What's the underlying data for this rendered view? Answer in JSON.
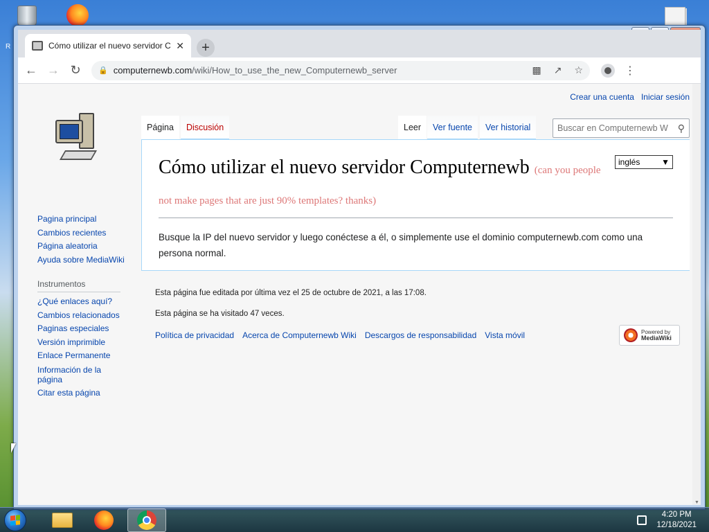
{
  "desktop": {
    "left_label": "R",
    "right_label": "......"
  },
  "browser": {
    "tab_title": "Cómo utilizar el nuevo servidor C",
    "url_host": "computernewb.com",
    "url_path": "/wiki/How_to_use_the_new_Computernewb_server"
  },
  "wiki": {
    "personal": {
      "create_account": "Crear una cuenta",
      "login": "Iniciar sesión"
    },
    "tabs": {
      "page": "Página",
      "talk": "Discusión",
      "read": "Leer",
      "view_source": "Ver fuente",
      "history": "Ver historial"
    },
    "search_placeholder": "Buscar en Computernewb W",
    "sidebar": {
      "nav": [
        "Pagina principal",
        "Cambios recientes",
        "Página aleatoria",
        "Ayuda sobre MediaWiki"
      ],
      "tools_heading": "Instrumentos",
      "tools": [
        "¿Qué enlaces aquí?",
        "Cambios relacionados",
        "Paginas especiales",
        "Versión imprimible",
        "Enlace Permanente",
        "Información de la página",
        "Citar esta página"
      ]
    },
    "language_select": "inglés",
    "title": "Cómo utilizar el nuevo servidor Computernewb",
    "subtitle": "(can you people not make pages that are just 90% templates? thanks)",
    "body": "Busque la IP del nuevo servidor y luego conéctese a él, o simplemente use el dominio computernewb.com como una persona normal.",
    "footer": {
      "last_edit": "Esta página fue editada por última vez el 25 de octubre de 2021, a las 17:08.",
      "views": "Esta página se ha visitado 47 veces.",
      "links": [
        "Política de privacidad",
        "Acerca de Computernewb Wiki",
        "Descargos de responsabilidad",
        "Vista móvil"
      ],
      "badge_line1": "Powered by",
      "badge_line2": "MediaWiki"
    }
  },
  "taskbar": {
    "time": "4:20 PM",
    "date": "12/18/2021"
  }
}
